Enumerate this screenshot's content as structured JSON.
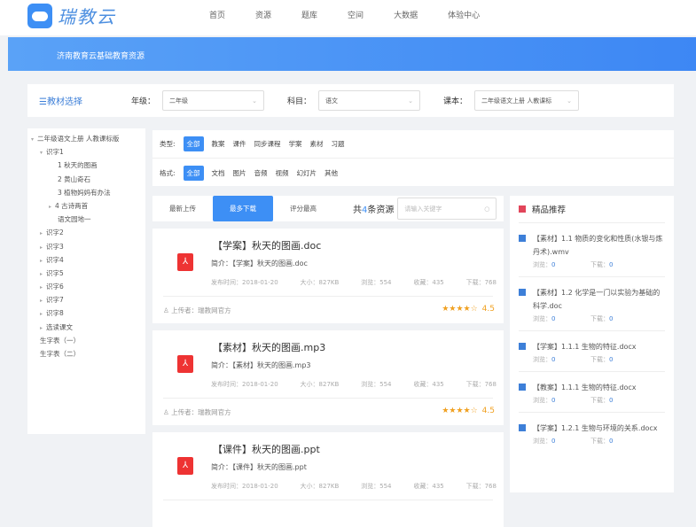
{
  "header": {
    "logo": "瑞教云",
    "nav": [
      "首页",
      "资源",
      "题库",
      "空间",
      "大数据",
      "体验中心"
    ]
  },
  "banner": {
    "title": "济南教育云基础教育资源"
  },
  "filter_bar": {
    "title": "☰教材选择",
    "grade_label": "年级：",
    "grade": "二年级",
    "subject_label": "科目：",
    "subject": "语文",
    "book_label": "课本：",
    "book": "二年级语文上册 人教课标"
  },
  "tree": [
    {
      "label": "二年级语文上册 人教课标版",
      "level": 0,
      "arrow": "▾"
    },
    {
      "label": "识字1",
      "level": 1,
      "arrow": "▾"
    },
    {
      "label": "1 秋天的图画",
      "level": 2,
      "arrow": ""
    },
    {
      "label": "2 黄山奇石",
      "level": 2,
      "arrow": ""
    },
    {
      "label": "3 植物妈妈有办法",
      "level": 2,
      "arrow": ""
    },
    {
      "label": "4 古诗两首",
      "level": 2,
      "arrow": "▸"
    },
    {
      "label": "语文园地一",
      "level": 2,
      "arrow": ""
    },
    {
      "label": "识字2",
      "level": 1,
      "arrow": "▸"
    },
    {
      "label": "识字3",
      "level": 1,
      "arrow": "▸"
    },
    {
      "label": "识字4",
      "level": 1,
      "arrow": "▸"
    },
    {
      "label": "识字5",
      "level": 1,
      "arrow": "▸"
    },
    {
      "label": "识字6",
      "level": 1,
      "arrow": "▸"
    },
    {
      "label": "识字7",
      "level": 1,
      "arrow": "▸"
    },
    {
      "label": "识字8",
      "level": 1,
      "arrow": "▸"
    },
    {
      "label": "选读课文",
      "level": 1,
      "arrow": "▸"
    },
    {
      "label": "生字表（一）",
      "level": 1,
      "arrow": ""
    },
    {
      "label": "生字表（二）",
      "level": 1,
      "arrow": ""
    }
  ],
  "filters": {
    "type_label": "类型:",
    "types": [
      "全部",
      "教案",
      "课件",
      "同步课程",
      "学案",
      "素材",
      "习题"
    ],
    "format_label": "格式:",
    "formats": [
      "全部",
      "文档",
      "图片",
      "音频",
      "视频",
      "幻灯片",
      "其他"
    ]
  },
  "sort": {
    "tabs": [
      "最新上传",
      "最多下载",
      "评分最高"
    ],
    "active": 1,
    "count_prefix": "共",
    "count": "4",
    "count_suffix": "条资源",
    "search_placeholder": "请输入关键字"
  },
  "resources": [
    {
      "title": "【学案】秋天的图画.doc",
      "desc_label": "简介：",
      "desc": "【学案】秋天的图画.doc",
      "date": "发布时间：2018-01-20",
      "size": "大小：827KB",
      "views": "浏览：554",
      "favs": "收藏：435",
      "downloads": "下载：768",
      "uploader": "上传者：瑞教网官方",
      "stars": "★★★★☆",
      "rating": "4.5"
    },
    {
      "title": "【素材】秋天的图画.mp3",
      "desc_label": "简介：",
      "desc": "【素材】秋天的图画.mp3",
      "date": "发布时间：2018-01-20",
      "size": "大小：827KB",
      "views": "浏览：554",
      "favs": "收藏：435",
      "downloads": "下载：768",
      "uploader": "上传者：瑞教网官方",
      "stars": "★★★★☆",
      "rating": "4.5"
    },
    {
      "title": "【课件】秋天的图画.ppt",
      "desc_label": "简介：",
      "desc": "【课件】秋天的图画.ppt",
      "date": "发布时间：2018-01-20",
      "size": "大小：827KB",
      "views": "浏览：554",
      "favs": "收藏：435",
      "downloads": "下载：768",
      "uploader": "",
      "stars": "",
      "rating": ""
    }
  ],
  "recommend": {
    "title": "精品推荐",
    "view_label": "浏览：",
    "down_label": "下载：",
    "items": [
      {
        "name": "【素材】1.1 物质的变化和性质(水银与炼丹术).wmv",
        "views": "0",
        "downloads": "0"
      },
      {
        "name": "【素材】1.2 化学是一门以实验为基础的科学.doc",
        "views": "0",
        "downloads": "0"
      },
      {
        "name": "【学案】1.1.1 生物的特征.docx",
        "views": "0",
        "downloads": "0"
      },
      {
        "name": "【教案】1.1.1 生物的特征.docx",
        "views": "0",
        "downloads": "0"
      },
      {
        "name": "【学案】1.2.1 生物与环境的关系.docx",
        "views": "0",
        "downloads": "0"
      }
    ]
  }
}
